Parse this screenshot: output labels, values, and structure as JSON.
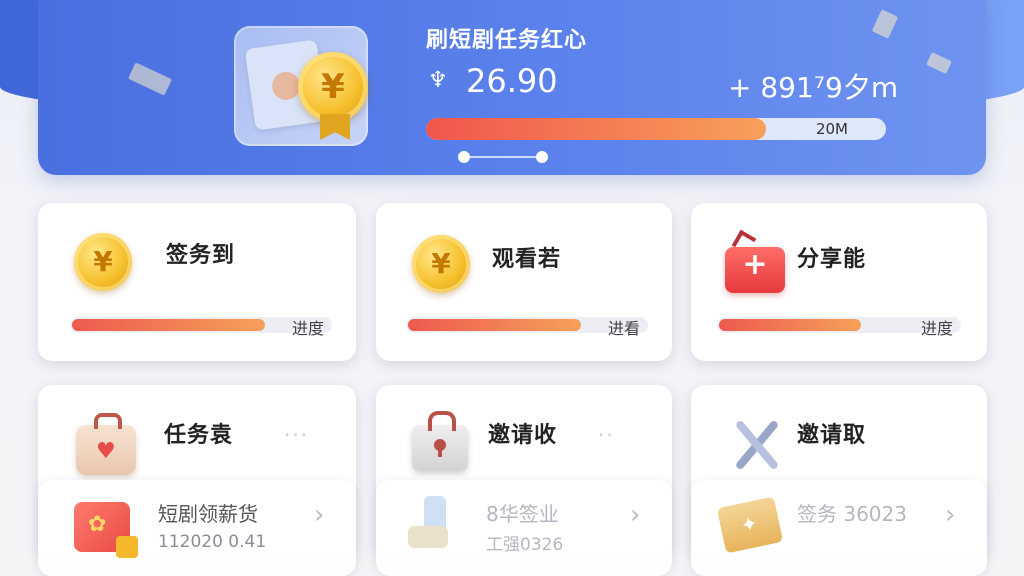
{
  "banner": {
    "title": "刷短剧任务红心",
    "amount": "26.90",
    "extra": "+ 891⁷9夕m",
    "progress_label": "20M",
    "progress_fraction": 0.74,
    "coin_symbol": "¥",
    "amount_icon": "trophy-icon"
  },
  "cards_top": [
    {
      "title": "签务到",
      "icon": "coin-icon",
      "progress_label": "进度",
      "progress_fraction": 0.75
    },
    {
      "title": "观看若",
      "icon": "coin-icon",
      "progress_label": "进看",
      "progress_fraction": 0.73
    },
    {
      "title": "分享能",
      "icon": "gift-box-icon",
      "progress_label": "进度",
      "progress_fraction": 0.6
    }
  ],
  "cards_bottom": [
    {
      "title": "任务袁",
      "icon": "bag-icon",
      "more": "···"
    },
    {
      "title": "邀请收",
      "icon": "lock-icon",
      "more": "··"
    },
    {
      "title": "邀请取",
      "icon": "tools-icon"
    }
  ],
  "sub_items": [
    {
      "name": "短剧领薪货",
      "meta": "112020 0.41",
      "icon": "red-packet-icon"
    },
    {
      "name": "8华签业",
      "meta": "工强0326",
      "icon": "bottle-icon"
    },
    {
      "name": "签务 36023",
      "meta": "",
      "icon": "envelope-icon"
    }
  ],
  "colors": {
    "banner_blue": "#4a6fe0",
    "progress_start": "#ee5a4e",
    "progress_end": "#f6a15a",
    "coin_gold": "#f6c02c"
  }
}
